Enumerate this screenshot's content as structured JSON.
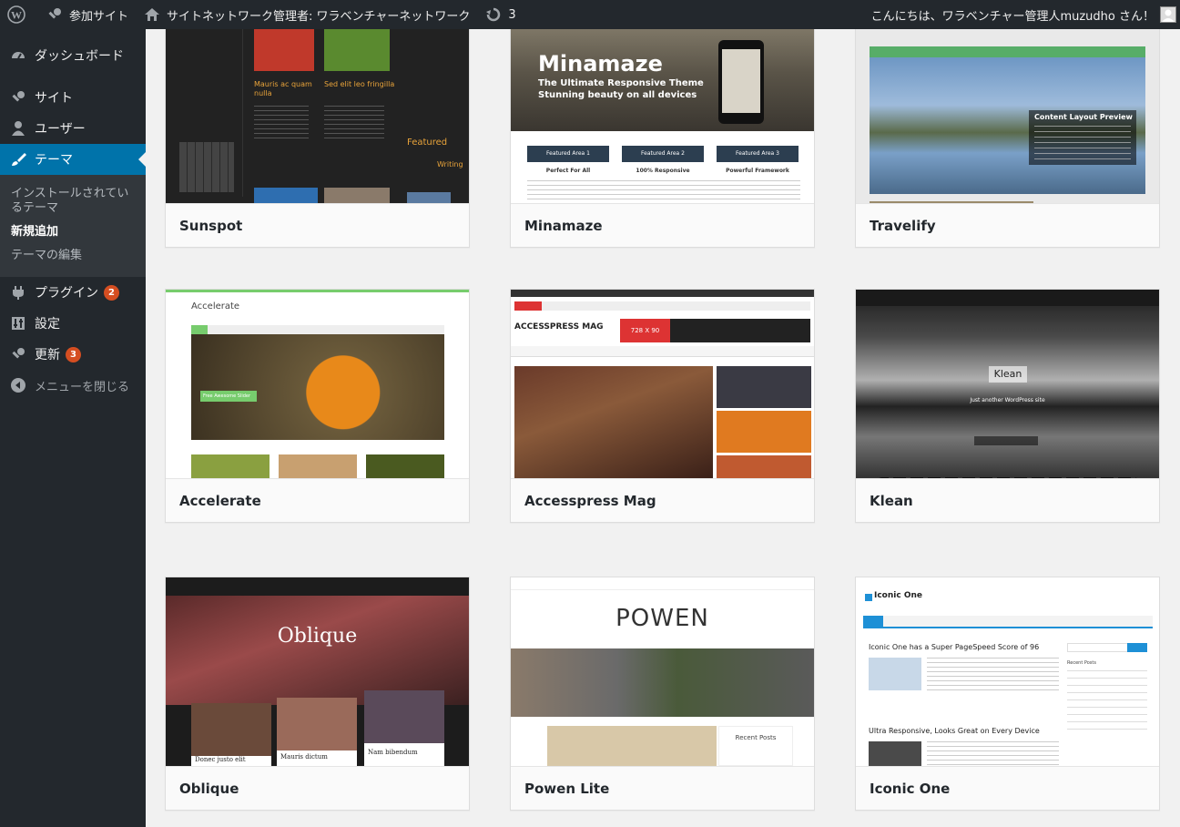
{
  "adminbar": {
    "my_sites": "参加サイト",
    "network_admin": "サイトネットワーク管理者: ワラベンチャーネットワーク",
    "updates_count": "3",
    "greeting": "こんにちは、ワラベンチャー管理人muzudho さん！"
  },
  "sidebar": {
    "dashboard": "ダッシュボード",
    "sites": "サイト",
    "users": "ユーザー",
    "themes": "テーマ",
    "sub_installed": "インストールされているテーマ",
    "sub_add_new": "新規追加",
    "sub_editor": "テーマの編集",
    "plugins": "プラグイン",
    "plugins_badge": "2",
    "settings": "設定",
    "updates": "更新",
    "updates_badge": "3",
    "collapse": "メニューを閉じる"
  },
  "themes": [
    {
      "name": "Sunspot"
    },
    {
      "name": "Minamaze"
    },
    {
      "name": "Travelify"
    },
    {
      "name": "Accelerate"
    },
    {
      "name": "Accesspress Mag"
    },
    {
      "name": "Klean"
    },
    {
      "name": "Oblique"
    },
    {
      "name": "Powen Lite"
    },
    {
      "name": "Iconic One"
    }
  ],
  "thumbs": {
    "minamaze_title": "Minamaze",
    "minamaze_sub1": "The Ultimate Responsive Theme",
    "minamaze_sub2": "Stunning beauty on all devices",
    "minamaze_f1": "Featured Area 1",
    "minamaze_f2": "Featured Area 2",
    "minamaze_f3": "Featured Area 3",
    "minamaze_c1": "Perfect For All",
    "minamaze_c2": "100% Responsive",
    "minamaze_c3": "Powerful Framework",
    "travelify_preview": "Content Layout Preview",
    "accelerate_logo": "Accelerate",
    "accelerate_slider": "Free Awesome Slider",
    "accesspress_logo": "ACCESSPRESS MAG",
    "accesspress_ad": "728 X 90",
    "klean_title": "Klean",
    "klean_sub": "Just another WordPress site",
    "oblique_title": "Oblique",
    "oblique_p1": "Donec justo elit",
    "oblique_p2": "Mauris dictum",
    "oblique_p3": "Nam bibendum",
    "powen_logo": "POWEN",
    "powen_recent": "Recent Posts",
    "iconic_logo": "Iconic One",
    "iconic_post1": "Iconic One has a Super PageSpeed Score of 96",
    "iconic_post2": "Ultra Responsive, Looks Great on Every Device",
    "iconic_recent": "Recent Posts",
    "sunspot_post1": "Mauris ac quam nulla",
    "sunspot_post2": "Sed elit leo fringilla",
    "sunspot_featured": "Featured",
    "sunspot_writing": "Writing"
  },
  "colors": {
    "adminbar_bg": "#23282d",
    "accent": "#0073aa",
    "badge": "#d54e21"
  }
}
